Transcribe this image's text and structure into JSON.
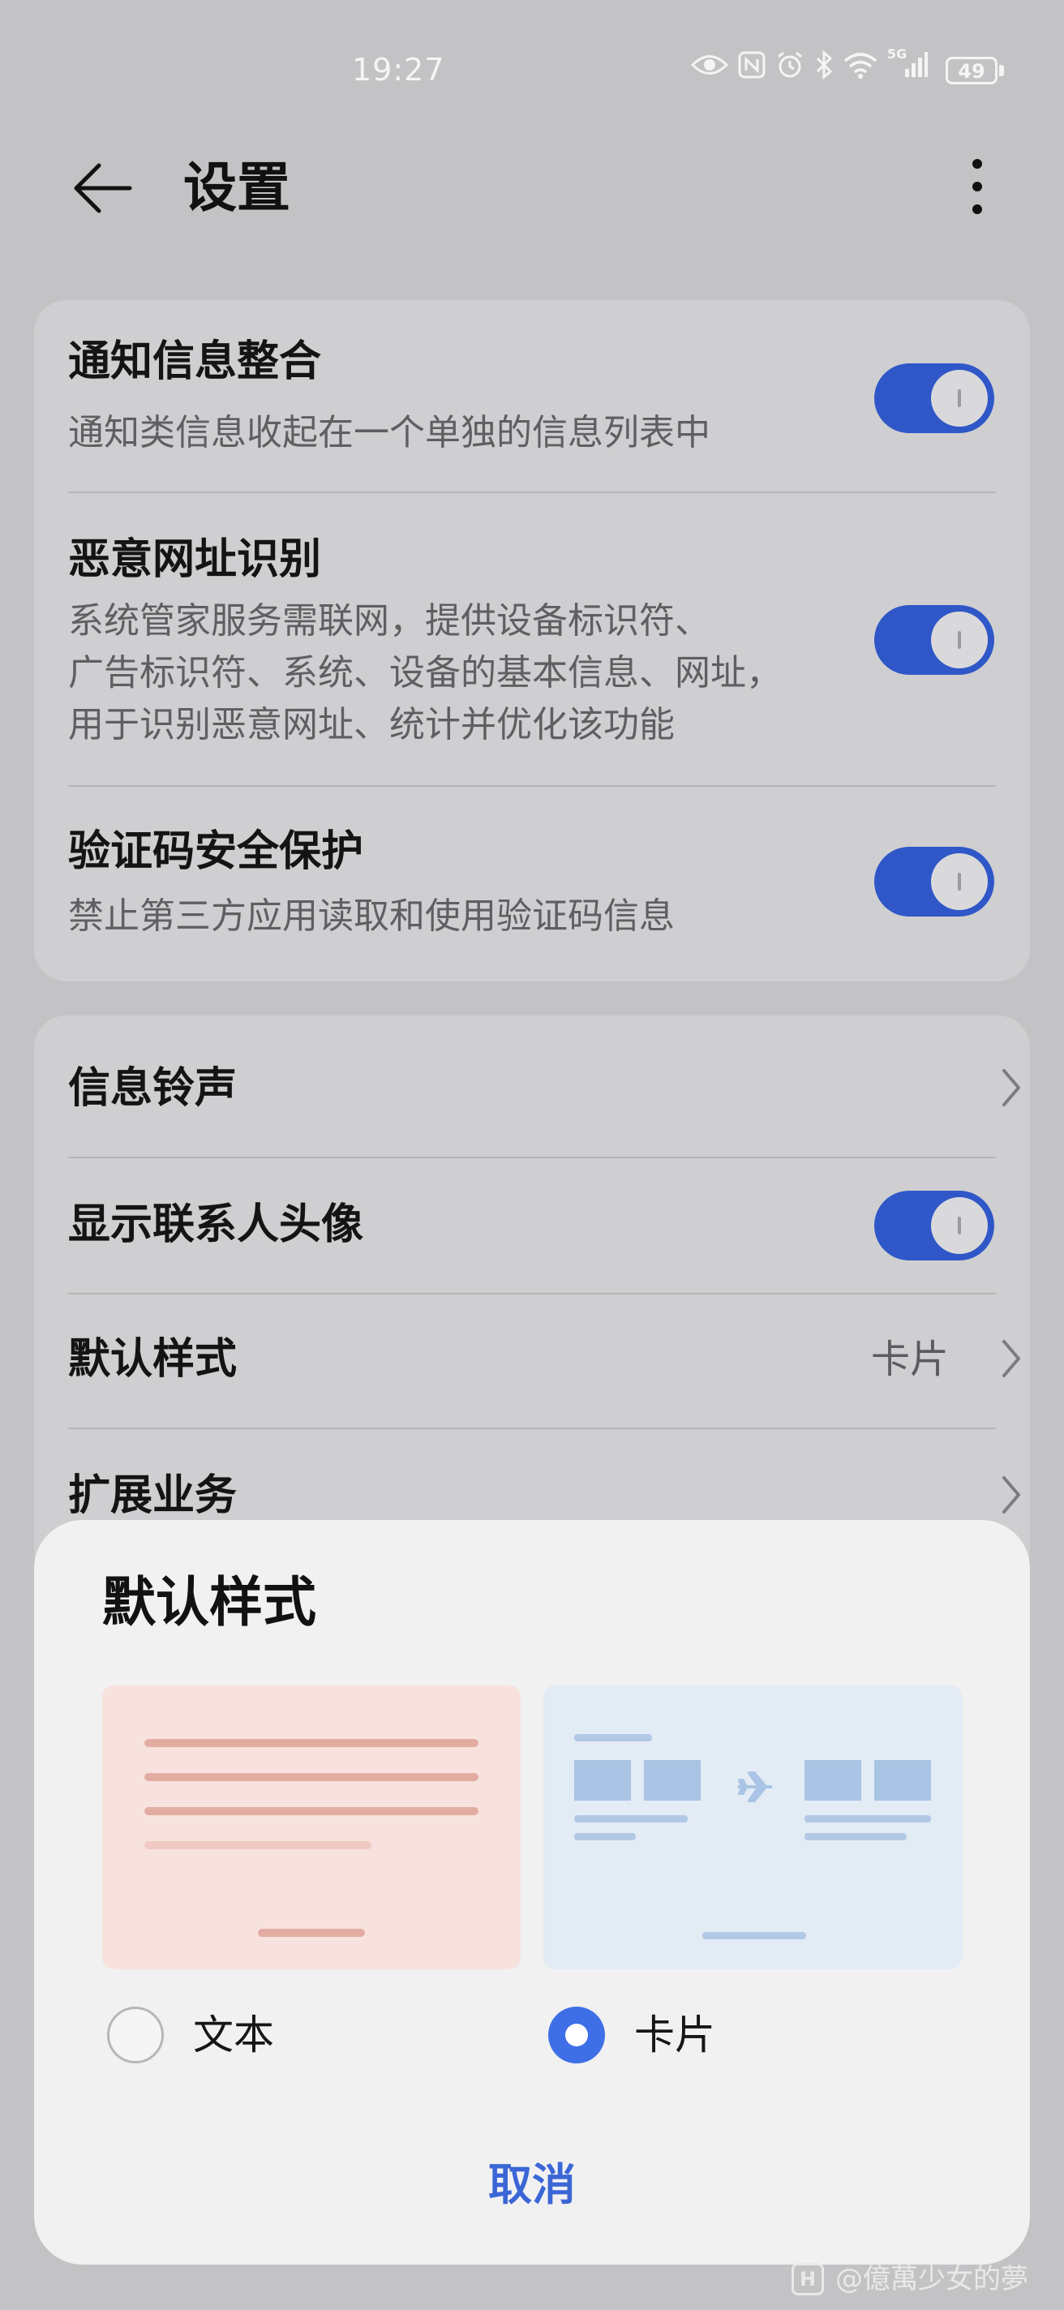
{
  "status_bar": {
    "time": "19:27",
    "battery": "49",
    "icons": [
      "eye-icon",
      "nfc-icon",
      "alarm-icon",
      "bluetooth-icon",
      "wifi-icon",
      "signal-icon"
    ],
    "network_label": "5G"
  },
  "header": {
    "back_icon": "arrow-left-icon",
    "title": "设置",
    "more_icon": "more-vertical-icon"
  },
  "settings_group1": [
    {
      "title": "通知信息整合",
      "subtitle": [
        "通知类信息收起在一个单独的信息列表中"
      ],
      "toggle": true
    },
    {
      "title": "恶意网址识别",
      "subtitle": [
        "系统管家服务需联网，提供设备标识符、",
        "广告标识符、系统、设备的基本信息、网址，",
        "用于识别恶意网址、统计并优化该功能"
      ],
      "toggle": true
    },
    {
      "title": "验证码安全保护",
      "subtitle": [
        "禁止第三方应用读取和使用验证码信息"
      ],
      "toggle": true
    }
  ],
  "settings_group2": [
    {
      "title": "信息铃声",
      "type": "chevron"
    },
    {
      "title": "显示联系人头像",
      "type": "toggle",
      "toggle": true
    },
    {
      "title": "默认样式",
      "type": "chevron",
      "value": "卡片"
    },
    {
      "title": "扩展业务",
      "type": "chevron"
    }
  ],
  "dialog": {
    "title": "默认样式",
    "options": [
      {
        "label": "文本",
        "selected": false
      },
      {
        "label": "卡片",
        "selected": true
      }
    ],
    "cancel_label": "取消"
  },
  "watermark": {
    "text": "@億萬少女的夢",
    "icon_letter": "H"
  },
  "colors": {
    "toggle_on": "#2f57c8",
    "radio_selected": "#3e6fe6",
    "cancel_text": "#3b66d6",
    "background": "#c3c3c5",
    "card": "#cfcfd1",
    "dialog": "#f1f1f2"
  }
}
